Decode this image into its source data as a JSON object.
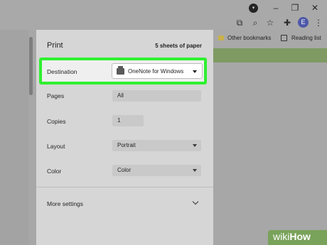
{
  "browser": {
    "profile_badge": "▾",
    "avatar_initial": "E",
    "icons": [
      "open-in-page-icon",
      "zoom-icon",
      "star-icon",
      "extensions-icon"
    ],
    "bookmarks": {
      "other_bookmarks": "Other bookmarks",
      "reading_list": "Reading list"
    }
  },
  "print_dialog": {
    "title": "Print",
    "sheets": "5 sheets of paper",
    "destination": {
      "label": "Destination",
      "value": "OneNote for Windows"
    },
    "pages": {
      "label": "Pages",
      "value": "All"
    },
    "copies": {
      "label": "Copies",
      "value": "1"
    },
    "layout": {
      "label": "Layout",
      "value": "Portrait"
    },
    "color": {
      "label": "Color",
      "value": "Color"
    },
    "more_settings": "More settings"
  },
  "watermark": {
    "prefix": "wiki",
    "suffix": "How"
  },
  "colors": {
    "highlight": "#2ff02f",
    "dialog_bg": "#d6d6d6",
    "avatar": "#4d58a8",
    "page_strip": "#7f9a63",
    "watermark": "#79a25a"
  }
}
